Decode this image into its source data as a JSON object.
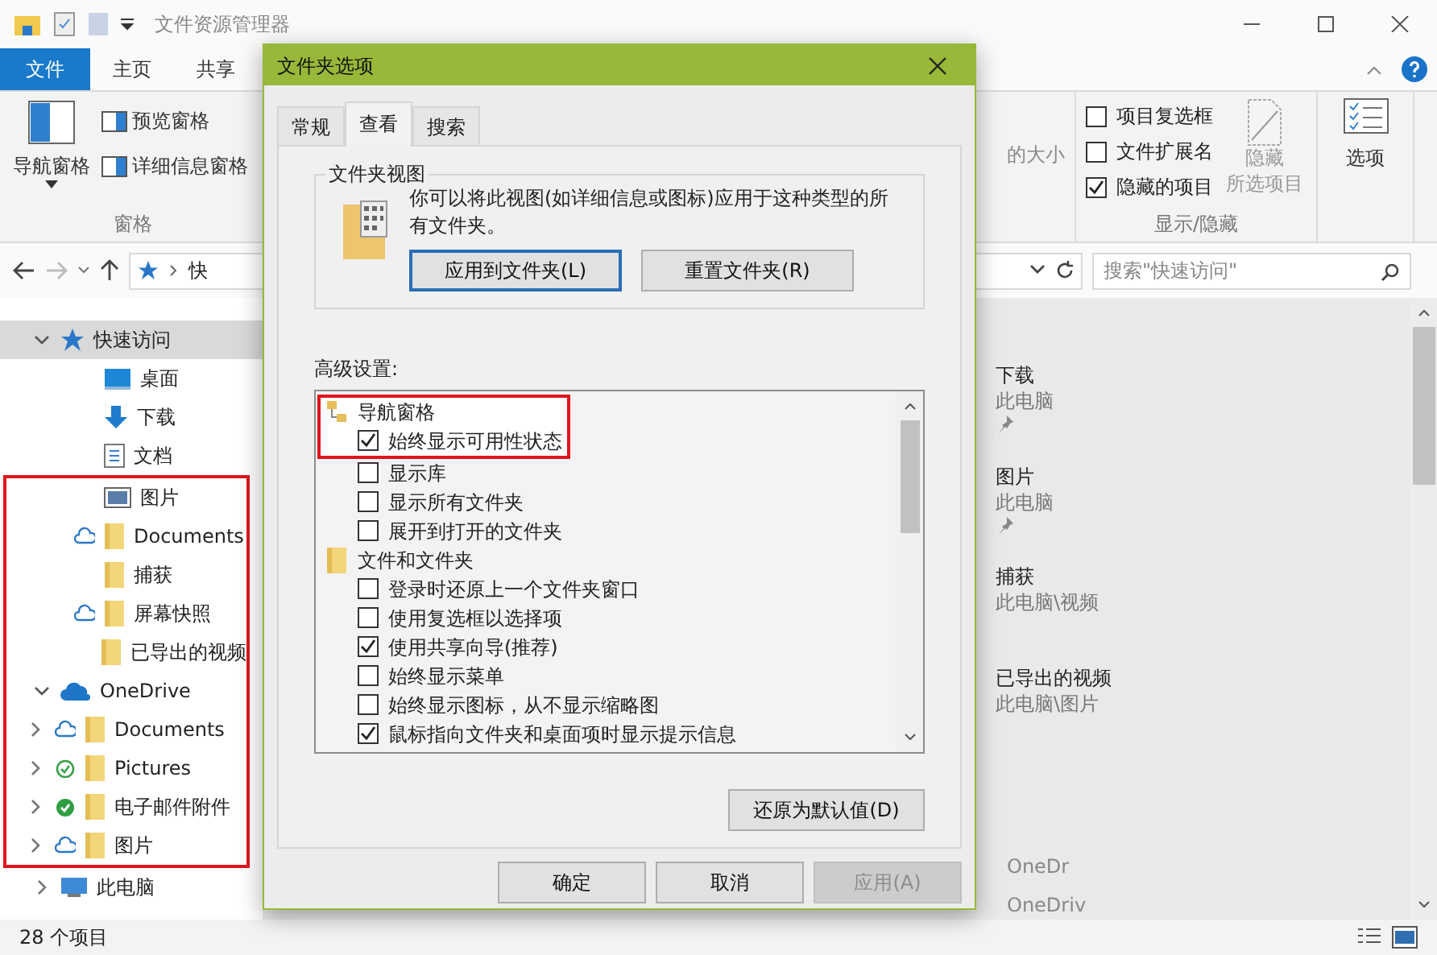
{
  "window": {
    "title": "文件资源管理器"
  },
  "ribbon_tabs": [
    {
      "label": "文件",
      "kind": "file"
    },
    {
      "label": "主页",
      "kind": "tab"
    },
    {
      "label": "共享",
      "kind": "tab"
    }
  ],
  "ribbon": {
    "panes": {
      "label": "窗格",
      "nav_pane": "导航窗格",
      "buttons": [
        "预览窗格",
        "详细信息窗格"
      ]
    },
    "partial_text": "的大小",
    "show_hide": {
      "label": "显示/隐藏",
      "checkboxes": [
        {
          "label": "项目复选框",
          "checked": false
        },
        {
          "label": "文件扩展名",
          "checked": false
        },
        {
          "label": "隐藏的项目",
          "checked": true
        }
      ],
      "hide_selected": {
        "lines": [
          "隐藏",
          "所选项目"
        ],
        "disabled": true
      }
    },
    "options": "选项"
  },
  "address": {
    "path": "快",
    "search_placeholder": "搜索\"快速访问\""
  },
  "nav": [
    {
      "label": "快速访问",
      "kind": "star",
      "expanded": true,
      "selected": true,
      "highlighted": false,
      "children": [
        {
          "label": "桌面",
          "kind": "desktop",
          "selected": false,
          "highlighted": false
        },
        {
          "label": "下载",
          "kind": "download",
          "selected": false,
          "highlighted": false
        },
        {
          "label": "文档",
          "kind": "document",
          "selected": false,
          "highlighted": false
        },
        {
          "label": "图片",
          "kind": "picture",
          "selected": false,
          "highlighted": true
        },
        {
          "label": "Documents",
          "kind": "folder",
          "sync_icon": {
            "kind": "cloud"
          },
          "selected": false,
          "highlighted": true
        },
        {
          "label": "捕获",
          "kind": "folder",
          "selected": false,
          "highlighted": true
        },
        {
          "label": "屏幕快照",
          "kind": "folder",
          "sync_icon": {
            "kind": "cloud"
          },
          "selected": false,
          "highlighted": true
        },
        {
          "label": "已导出的视频",
          "kind": "folder",
          "selected": false,
          "highlighted": true
        }
      ]
    },
    {
      "label": "OneDrive",
      "kind": "onedrive",
      "expanded": true,
      "selected": false,
      "highlighted": true,
      "children": [
        {
          "label": "Documents",
          "kind": "folder",
          "sync_icon": {
            "kind": "cloud"
          },
          "expanded": false,
          "selected": false,
          "highlighted": true
        },
        {
          "label": "Pictures",
          "kind": "folder",
          "sync_icon": {
            "kind": "available"
          },
          "expanded": false,
          "selected": false,
          "highlighted": true
        },
        {
          "label": "电子邮件附件",
          "kind": "folder",
          "sync_icon": {
            "kind": "synced"
          },
          "expanded": false,
          "selected": false,
          "highlighted": true
        },
        {
          "label": "图片",
          "kind": "folder",
          "sync_icon": {
            "kind": "cloud"
          },
          "expanded": false,
          "selected": false,
          "highlighted": true
        }
      ]
    },
    {
      "label": "此电脑",
      "kind": "pc",
      "expanded": false,
      "selected": false,
      "highlighted": false
    }
  ],
  "content": {
    "items": [
      {
        "name": "下载",
        "location": "此电脑",
        "pinned": true
      },
      {
        "name": "图片",
        "location": "此电脑",
        "pinned": true
      },
      {
        "name": "捕获",
        "location": "此电脑\\视频",
        "pinned": false
      },
      {
        "name": "已导出的视频",
        "location": "此电脑\\图片",
        "pinned": false
      }
    ],
    "list_rows": [
      {
        "column_1": "OneDr"
      },
      {
        "column_1": "OneDriv"
      }
    ]
  },
  "status_bar": {
    "count": "28 个项目"
  },
  "dialog": {
    "title": "文件夹选项",
    "tabs": [
      {
        "label": "常规",
        "selected": false
      },
      {
        "label": "查看",
        "selected": true
      },
      {
        "label": "搜索",
        "selected": false
      }
    ],
    "folder_views": {
      "legend": "文件夹视图",
      "text": "你可以将此视图(如详细信息或图标)应用于这种类型的所有文件夹。",
      "buttons": [
        {
          "label": "应用到文件夹(L)",
          "focused": true
        },
        {
          "label": "重置文件夹(R)",
          "focused": false
        }
      ]
    },
    "advanced_label": "高级设置:",
    "advanced": [
      {
        "label": "导航窗格",
        "kind": "nav-pane",
        "highlighted": true,
        "children": [
          {
            "label": "始终显示可用性状态",
            "checked": true,
            "highlighted": true
          },
          {
            "label": "显示库",
            "checked": false,
            "highlighted": false
          },
          {
            "label": "显示所有文件夹",
            "checked": false,
            "highlighted": false
          },
          {
            "label": "展开到打开的文件夹",
            "checked": false,
            "highlighted": false
          }
        ]
      },
      {
        "label": "文件和文件夹",
        "kind": "folder",
        "highlighted": false,
        "children": [
          {
            "label": "登录时还原上一个文件夹窗口",
            "checked": false,
            "highlighted": false
          },
          {
            "label": "使用复选框以选择项",
            "checked": false,
            "highlighted": false
          },
          {
            "label": "使用共享向导(推荐)",
            "checked": true,
            "highlighted": false
          },
          {
            "label": "始终显示菜单",
            "checked": false,
            "highlighted": false
          },
          {
            "label": "始终显示图标，从不显示缩略图",
            "checked": false,
            "highlighted": false
          },
          {
            "label": "鼠标指向文件夹和桌面项时显示提示信息",
            "checked": true,
            "highlighted": false
          }
        ]
      }
    ],
    "restore_button": "还原为默认值(D)",
    "footer_buttons": [
      {
        "label": "确定",
        "disabled": false
      },
      {
        "label": "取消",
        "disabled": false
      },
      {
        "label": "应用(A)",
        "disabled": true
      }
    ]
  }
}
